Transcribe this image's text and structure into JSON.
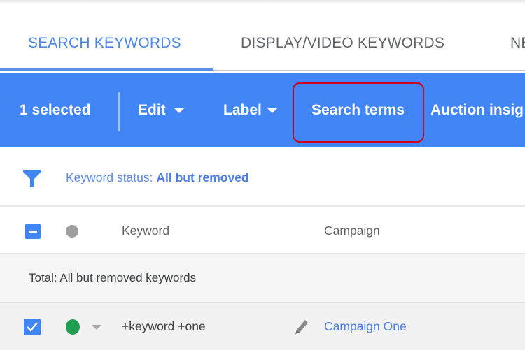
{
  "tabs": [
    {
      "label": "SEARCH KEYWORDS",
      "active": true
    },
    {
      "label": "DISPLAY/VIDEO KEYWORDS",
      "active": false
    },
    {
      "label": "NE",
      "active": false
    }
  ],
  "toolbar": {
    "selected_label": "1 selected",
    "edit_label": "Edit",
    "label_label": "Label",
    "search_terms_label": "Search terms",
    "auction_label": "Auction insig",
    "background_color": "#4285F4",
    "highlight_color": "#D0021B"
  },
  "filter": {
    "icon": "filter-funnel-icon",
    "prefix": "Keyword status: ",
    "value": "All but removed"
  },
  "table": {
    "columns": [
      "Keyword",
      "Campaign"
    ],
    "total_label": "Total: All but removed keywords",
    "rows": [
      {
        "checked": true,
        "status": "enabled",
        "status_color": "#1E9E50",
        "keyword": "+keyword +one",
        "campaign": "Campaign One"
      }
    ]
  }
}
